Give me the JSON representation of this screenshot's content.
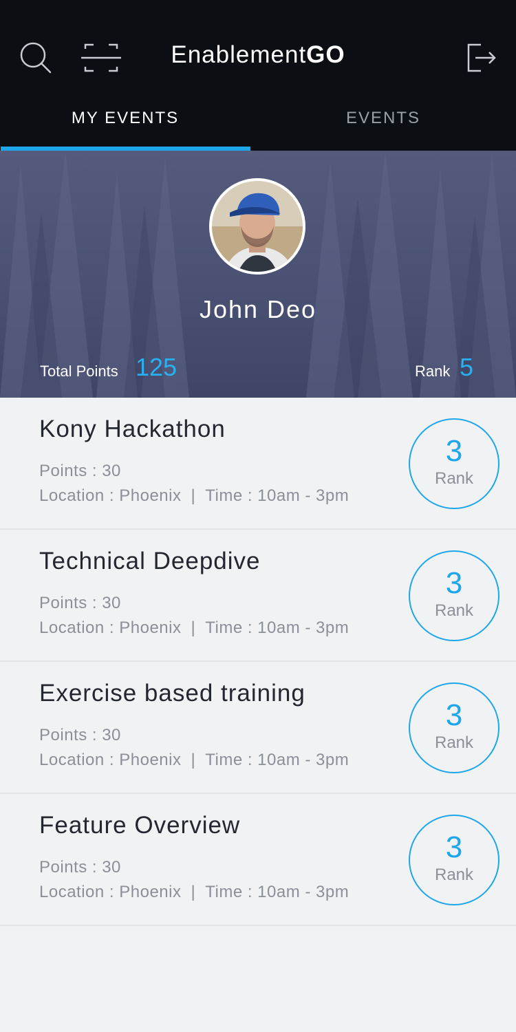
{
  "header": {
    "title_regular": "Enablement",
    "title_bold": "GO",
    "icons": {
      "search": "search-icon",
      "scan": "scan-icon",
      "logout": "logout-icon"
    }
  },
  "tabs": [
    {
      "label": "MY EVENTS",
      "active": true
    },
    {
      "label": "EVENTS",
      "active": false
    }
  ],
  "profile": {
    "name": "John Deo",
    "total_points_label": "Total Points",
    "total_points_value": "125",
    "rank_label": "Rank",
    "rank_value": "5"
  },
  "events": [
    {
      "title": "Kony Hackathon",
      "points": "Points : 30",
      "location": "Location : Phoenix",
      "separator": "|",
      "time": "Time : 10am - 3pm",
      "rank_value": "3",
      "rank_label": "Rank"
    },
    {
      "title": "Technical Deepdive",
      "points": "Points : 30",
      "location": "Location : Phoenix",
      "separator": "|",
      "time": "Time : 10am - 3pm",
      "rank_value": "3",
      "rank_label": "Rank"
    },
    {
      "title": "Exercise based training",
      "points": "Points : 30",
      "location": "Location : Phoenix",
      "separator": "|",
      "time": "Time : 10am - 3pm",
      "rank_value": "3",
      "rank_label": "Rank"
    },
    {
      "title": "Feature Overview",
      "points": "Points : 30",
      "location": "Location : Phoenix",
      "separator": "|",
      "time": "Time : 10am - 3pm",
      "rank_value": "3",
      "rank_label": "Rank"
    }
  ],
  "colors": {
    "accent": "#1ea6ea",
    "header_bg": "#0b0f14",
    "list_bg": "#f1f2f4"
  }
}
